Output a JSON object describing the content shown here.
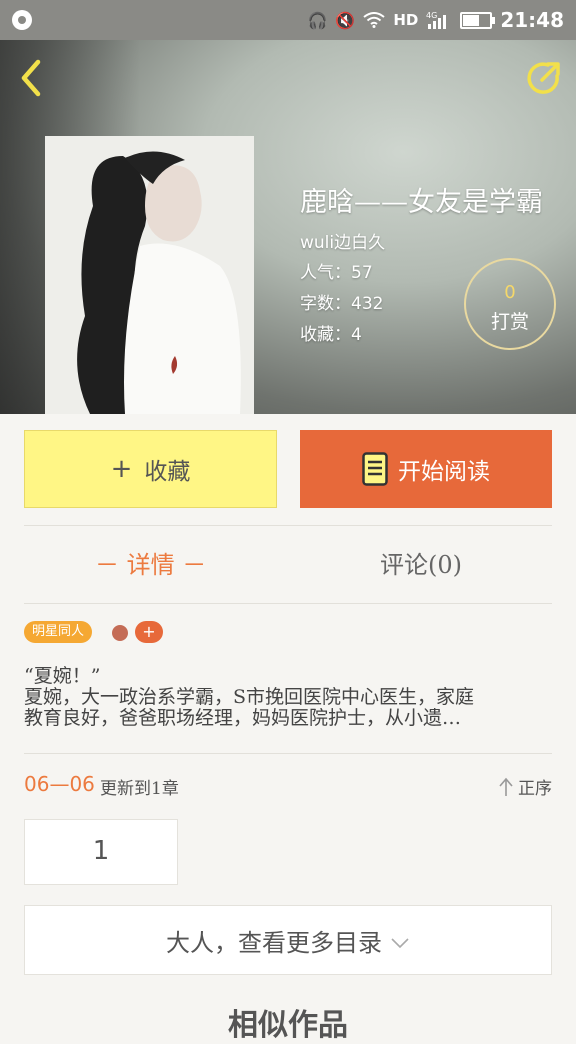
{
  "status_bar": {
    "network": "HD",
    "signal": "4G",
    "time": "21:48"
  },
  "book": {
    "title": "鹿晗——女友是学霸",
    "author": "wuli边白久",
    "popularity": "人气：57",
    "word_count": "字数：432",
    "favorites": "收藏：4"
  },
  "reward": {
    "count": "0",
    "label": "打赏"
  },
  "actions": {
    "favorite_icon": "+",
    "favorite_label": "收藏",
    "read_label": "开始阅读"
  },
  "tabs": {
    "detail": "－ 详情 －",
    "comments": "评论(0)"
  },
  "tags": {
    "primary": "明星同人",
    "add": "+"
  },
  "intro": {
    "line1": "“夏婉！”",
    "line2": "夏婉，大一政治系学霸，S市挽回医院中心医生，家庭",
    "line3": "教育良好，爸爸职场经理，妈妈医院护士，从小遗…"
  },
  "chapters": {
    "date": "06—06",
    "update": "更新到1章",
    "sort_label": "正序",
    "first_chapter": "1",
    "more_label": "大人，查看更多目录"
  },
  "section": {
    "similar_title": "相似作品"
  },
  "colors": {
    "accent": "#e7693a",
    "favorite_bg": "#fff685",
    "tag": "#f5a833"
  },
  "icons": {
    "back": "chevron-left-icon",
    "share": "share-icon",
    "book": "book-icon",
    "sort": "arrow-up-icon",
    "more": "chevron-down-icon"
  }
}
